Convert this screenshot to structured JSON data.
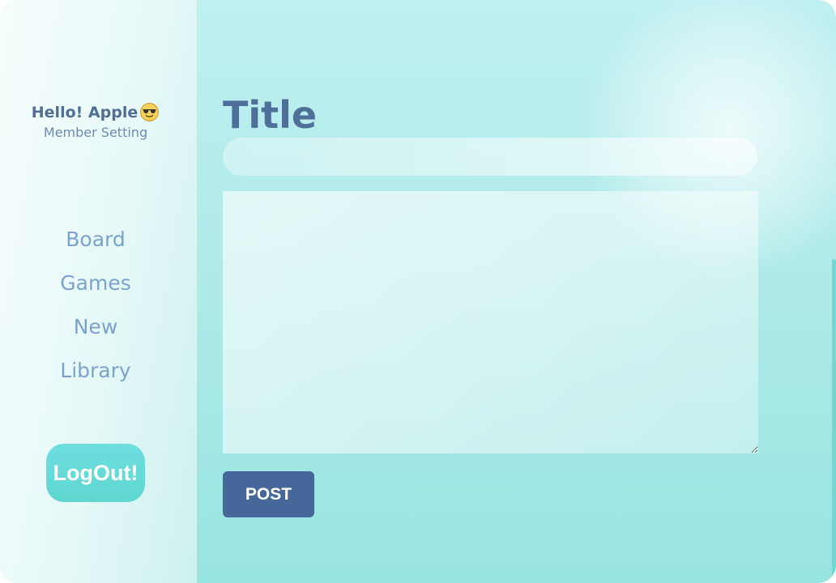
{
  "sidebar": {
    "greeting": "Hello! Apple",
    "greeting_icon": "smiling-face-with-sunglasses-icon",
    "member_setting": "Member Setting",
    "nav_items": [
      {
        "label": "Board"
      },
      {
        "label": "Games"
      },
      {
        "label": "New"
      },
      {
        "label": "Library"
      }
    ],
    "logout_label": "LogOut!"
  },
  "main": {
    "title_label": "Title",
    "title_input": {
      "value": "",
      "placeholder": ""
    },
    "content_input": {
      "value": "",
      "placeholder": ""
    },
    "post_label": "POST"
  },
  "colors": {
    "accent": "#46679a",
    "heading": "#4e6f99",
    "nav_text": "#7ba2cc",
    "logout_bg": "#5ed7cf",
    "background": "#aeeae8"
  }
}
